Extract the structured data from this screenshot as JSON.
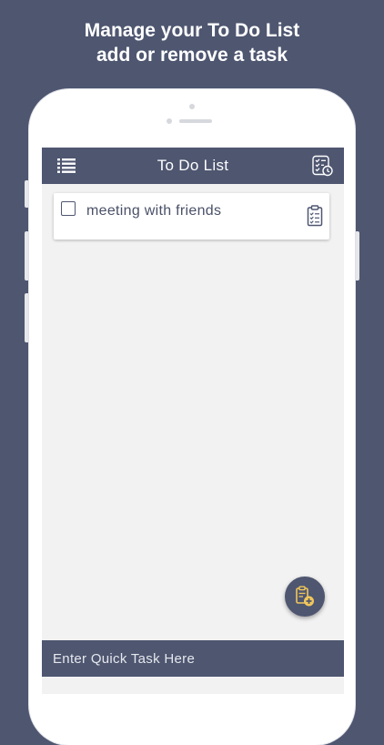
{
  "promo": {
    "line1": "Manage your To Do List",
    "line2": "add or remove a task"
  },
  "appbar": {
    "title": "To Do List",
    "menu_icon": "list-icon",
    "action_icon": "checklist-icon"
  },
  "tasks": [
    {
      "text": "meeting with friends",
      "checked": false,
      "icon": "clipboard-icon"
    }
  ],
  "fab": {
    "icon": "add-task-icon"
  },
  "quick_task": {
    "placeholder": "Enter Quick Task Here",
    "value": ""
  },
  "colors": {
    "primary": "#4e5670",
    "background": "#f2f2f2",
    "card": "#ffffff"
  }
}
